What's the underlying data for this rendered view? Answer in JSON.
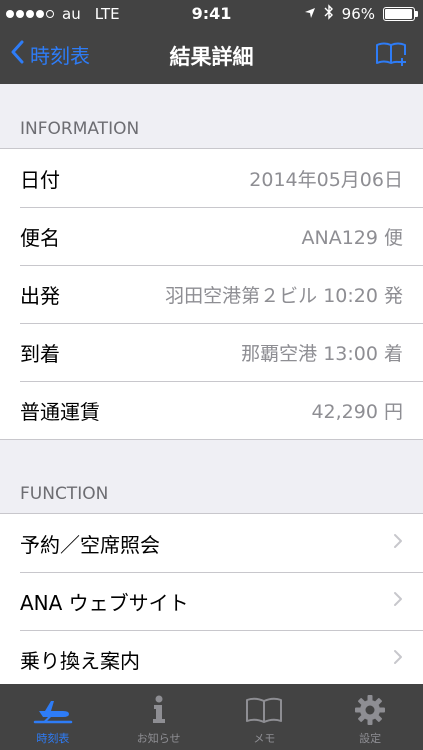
{
  "status_bar": {
    "carrier": "au",
    "network": "LTE",
    "time": "9:41",
    "battery": "96%",
    "battery_level": 0.96
  },
  "nav": {
    "back_label": "時刻表",
    "title": "結果詳細",
    "action_icon": "bookmark-add-icon"
  },
  "information": {
    "header": "INFORMATION",
    "rows": [
      {
        "label": "日付",
        "value": "2014年05月06日"
      },
      {
        "label": "便名",
        "value": "ANA129 便"
      },
      {
        "label": "出発",
        "value": "羽田空港第２ビル 10:20 発"
      },
      {
        "label": "到着",
        "value": "那覇空港 13:00 着"
      },
      {
        "label": "普通運賃",
        "value": "42,290 円"
      }
    ]
  },
  "function": {
    "header": "FUNCTION",
    "rows": [
      {
        "label": "予約／空席照会"
      },
      {
        "label": "ANA ウェブサイト"
      },
      {
        "label": "乗り換え案内"
      }
    ]
  },
  "tabs": [
    {
      "label": "時刻表",
      "icon": "airplane-icon",
      "active": true
    },
    {
      "label": "お知らせ",
      "icon": "info-icon",
      "active": false
    },
    {
      "label": "メモ",
      "icon": "book-icon",
      "active": false
    },
    {
      "label": "設定",
      "icon": "gear-icon",
      "active": false
    }
  ],
  "colors": {
    "accent": "#2e7cf6",
    "bar_background": "#434343",
    "page_background": "#efeff4"
  }
}
